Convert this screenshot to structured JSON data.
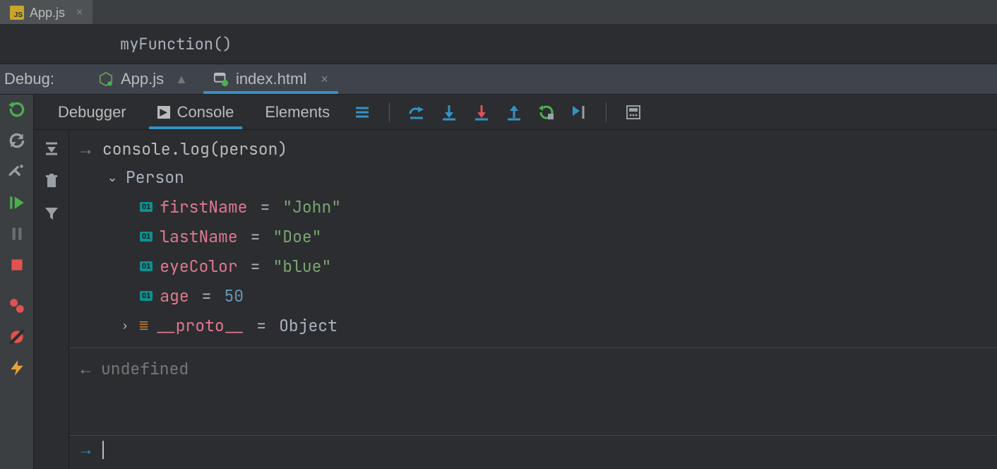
{
  "editor": {
    "tab_label": "App.js"
  },
  "breadcrumb": "myFunction()",
  "debug": {
    "label": "Debug:",
    "configs": [
      {
        "label": "App.js",
        "active": false,
        "pinned": true,
        "closable": false,
        "icon": "nodejs"
      },
      {
        "label": "index.html",
        "active": true,
        "pinned": false,
        "closable": true,
        "icon": "browser"
      }
    ]
  },
  "inner_tabs": [
    {
      "label": "Debugger",
      "active": false,
      "icon": null
    },
    {
      "label": "Console",
      "active": true,
      "icon": "play-square"
    },
    {
      "label": "Elements",
      "active": false,
      "icon": null
    }
  ],
  "console": {
    "input": "console.log(person)",
    "object_label": "Person",
    "properties": [
      {
        "name": "firstName",
        "value": "\"John\"",
        "type": "string"
      },
      {
        "name": "lastName",
        "value": "\"Doe\"",
        "type": "string"
      },
      {
        "name": "eyeColor",
        "value": "\"blue\"",
        "type": "string"
      },
      {
        "name": "age",
        "value": "50",
        "type": "number"
      }
    ],
    "proto_label": "__proto__",
    "proto_value": "Object",
    "return_value": "undefined"
  }
}
